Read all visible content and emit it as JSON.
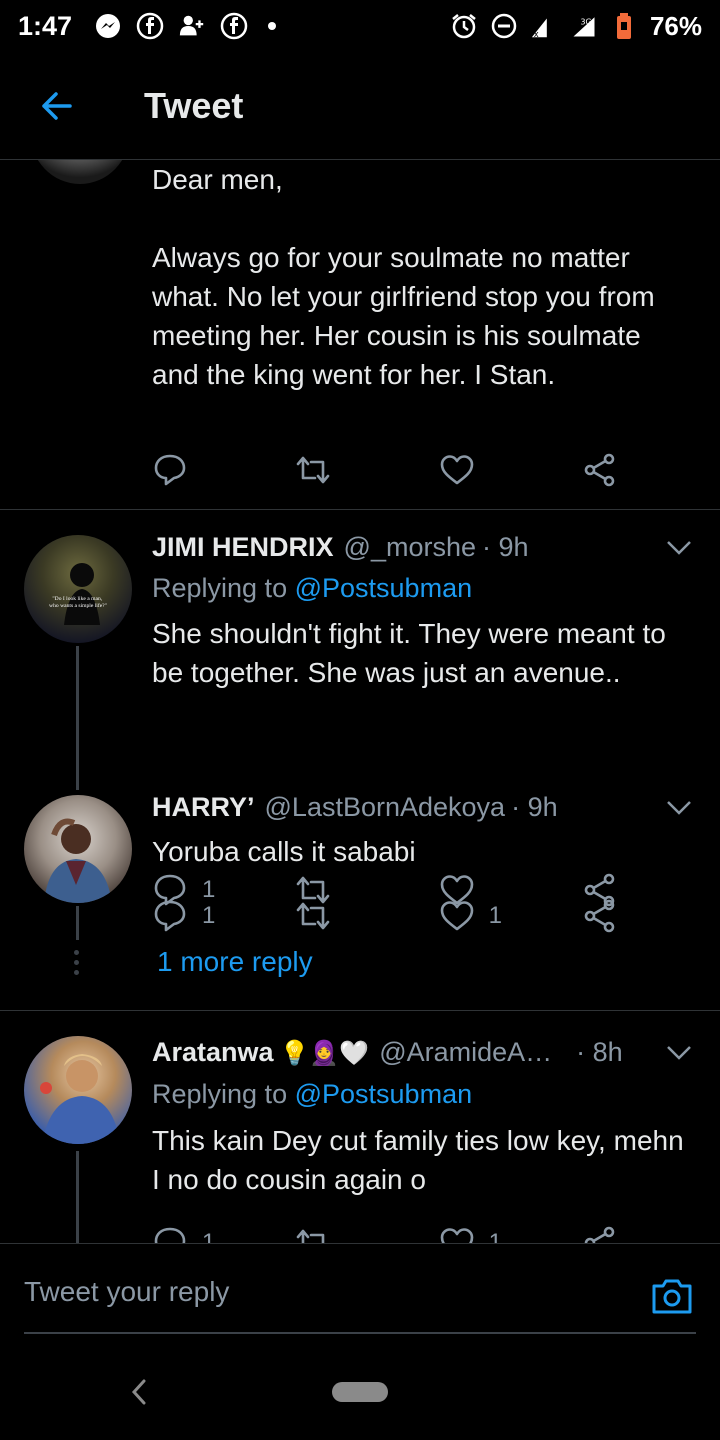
{
  "status_bar": {
    "time": "1:47",
    "battery": "76%",
    "network": "3G"
  },
  "header": {
    "title": "Tweet"
  },
  "main_tweet": {
    "text": "Dear men,\n\nAlways go for your soulmate no matter what. No let your girlfriend stop you from meeting her. Her cousin is his soulmate and the king went for her. I Stan."
  },
  "replies": [
    {
      "name": "JIMI HENDRIX",
      "handle": "@_morshe",
      "time": "· 9h",
      "replying_prefix": "Replying to",
      "replying_to": "@Postsubman",
      "text": "She shouldn't fight it. They were meant to be together. She was just an avenue..",
      "avatar_text": "\"Do I look like a man, who wants a simple life?\"",
      "reply_count": "1",
      "like_count": ""
    },
    {
      "name": "HARRY’",
      "handle": "@LastBornAdekoya",
      "time": "· 9h",
      "text": "Yoruba calls it sababi",
      "reply_count": "1",
      "like_count": "1"
    },
    {
      "name": "Aratanwa",
      "name_emojis": "💡🧕🤍",
      "handle": "@AramideA…",
      "time": "· 8h",
      "replying_prefix": "Replying to",
      "replying_to": "@Postsubman",
      "text": "This kain Dey cut family ties low key, mehn I no do cousin again o",
      "reply_count": "1",
      "like_count": "1"
    }
  ],
  "more_reply_label": "1 more reply",
  "compose": {
    "placeholder": "Tweet your reply"
  },
  "colors": {
    "background": "#000000",
    "accent": "#1d9bf0",
    "secondary_text": "#8b98a5",
    "divider": "#2f3336"
  }
}
